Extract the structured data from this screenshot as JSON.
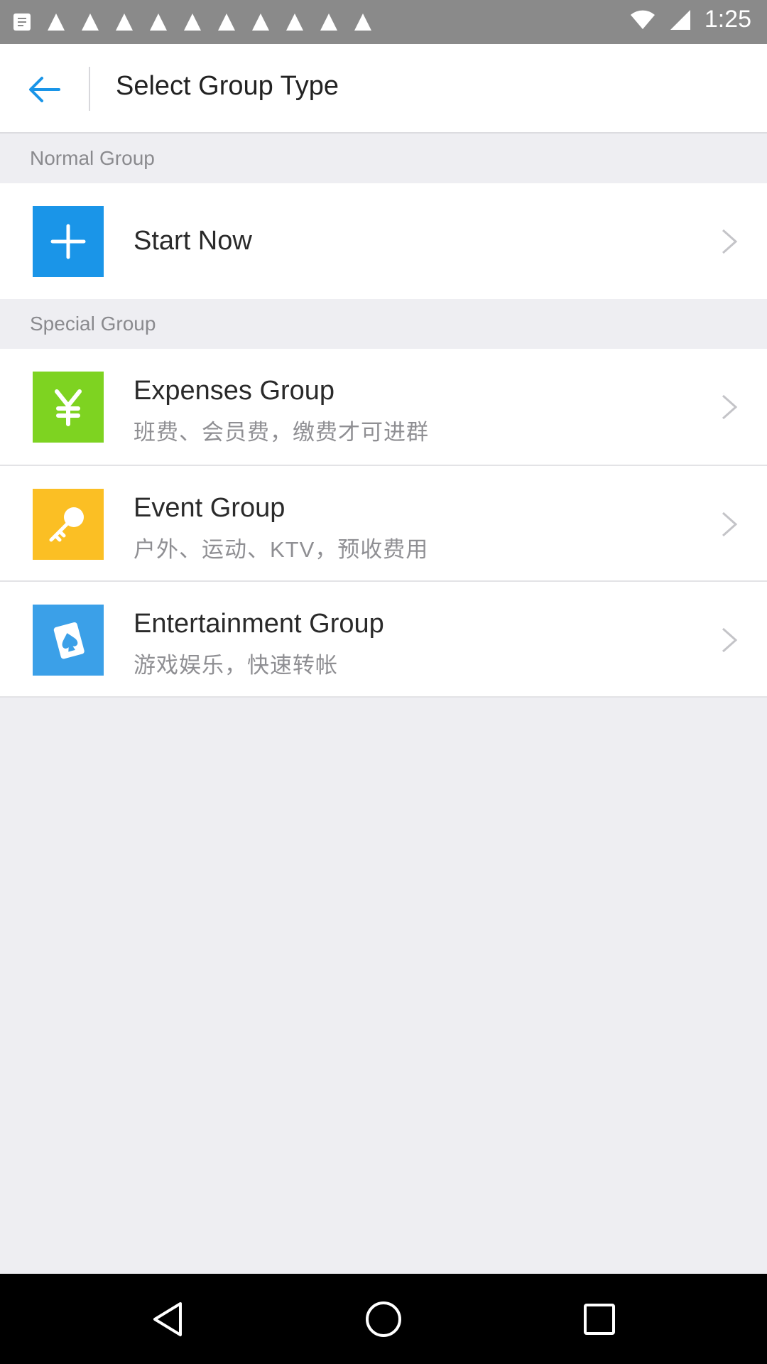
{
  "status_bar": {
    "time": "1:25",
    "notification_icons": [
      "app-notification-icon",
      "app-notification-icon",
      "app-notification-icon",
      "app-notification-icon",
      "app-notification-icon",
      "app-notification-icon",
      "app-notification-icon",
      "app-notification-icon",
      "app-notification-icon",
      "app-notification-icon",
      "app-notification-icon",
      "app-notification-icon",
      "app-notification-icon"
    ],
    "right_icons": [
      "wifi-icon",
      "signal-icon"
    ]
  },
  "app_bar": {
    "back_icon": "arrow-left-icon",
    "title": "Select Group Type"
  },
  "sections": {
    "normal": {
      "header": "Normal Group",
      "items": [
        {
          "icon": "plus-icon",
          "color": "#1a95e8",
          "title": "Start Now",
          "subtitle": ""
        }
      ]
    },
    "special": {
      "header": "Special Group",
      "items": [
        {
          "icon": "yen-icon",
          "color": "#7ed321",
          "title": "Expenses Group",
          "subtitle": "班费、会员费，缴费才可进群"
        },
        {
          "icon": "key-icon",
          "color": "#fbbf24",
          "title": "Event Group",
          "subtitle": "户外、运动、KTV，预收费用"
        },
        {
          "icon": "playing-card-icon",
          "color": "#3ba0e8",
          "title": "Entertainment Group",
          "subtitle": "游戏娱乐，快速转帐"
        }
      ]
    }
  },
  "nav_bar": {
    "icons": [
      "back-triangle-icon",
      "home-circle-icon",
      "recents-square-icon"
    ]
  },
  "colors": {
    "accent": "#1a95e8",
    "background": "#eeeef2",
    "status_bar": "#8a8a8a"
  }
}
